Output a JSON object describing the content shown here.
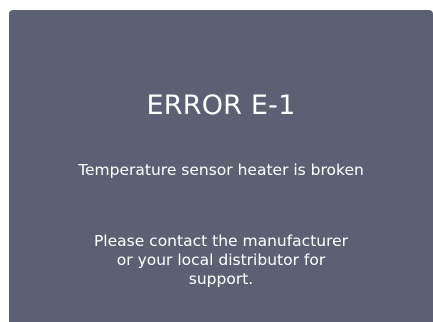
{
  "error_dialog": {
    "title": "ERROR E-1",
    "message": "Temperature sensor heater is broken",
    "support_lines": [
      "Please contact the manufacturer",
      "or your local distributor for",
      "support."
    ],
    "background_color": "#5b6172"
  }
}
